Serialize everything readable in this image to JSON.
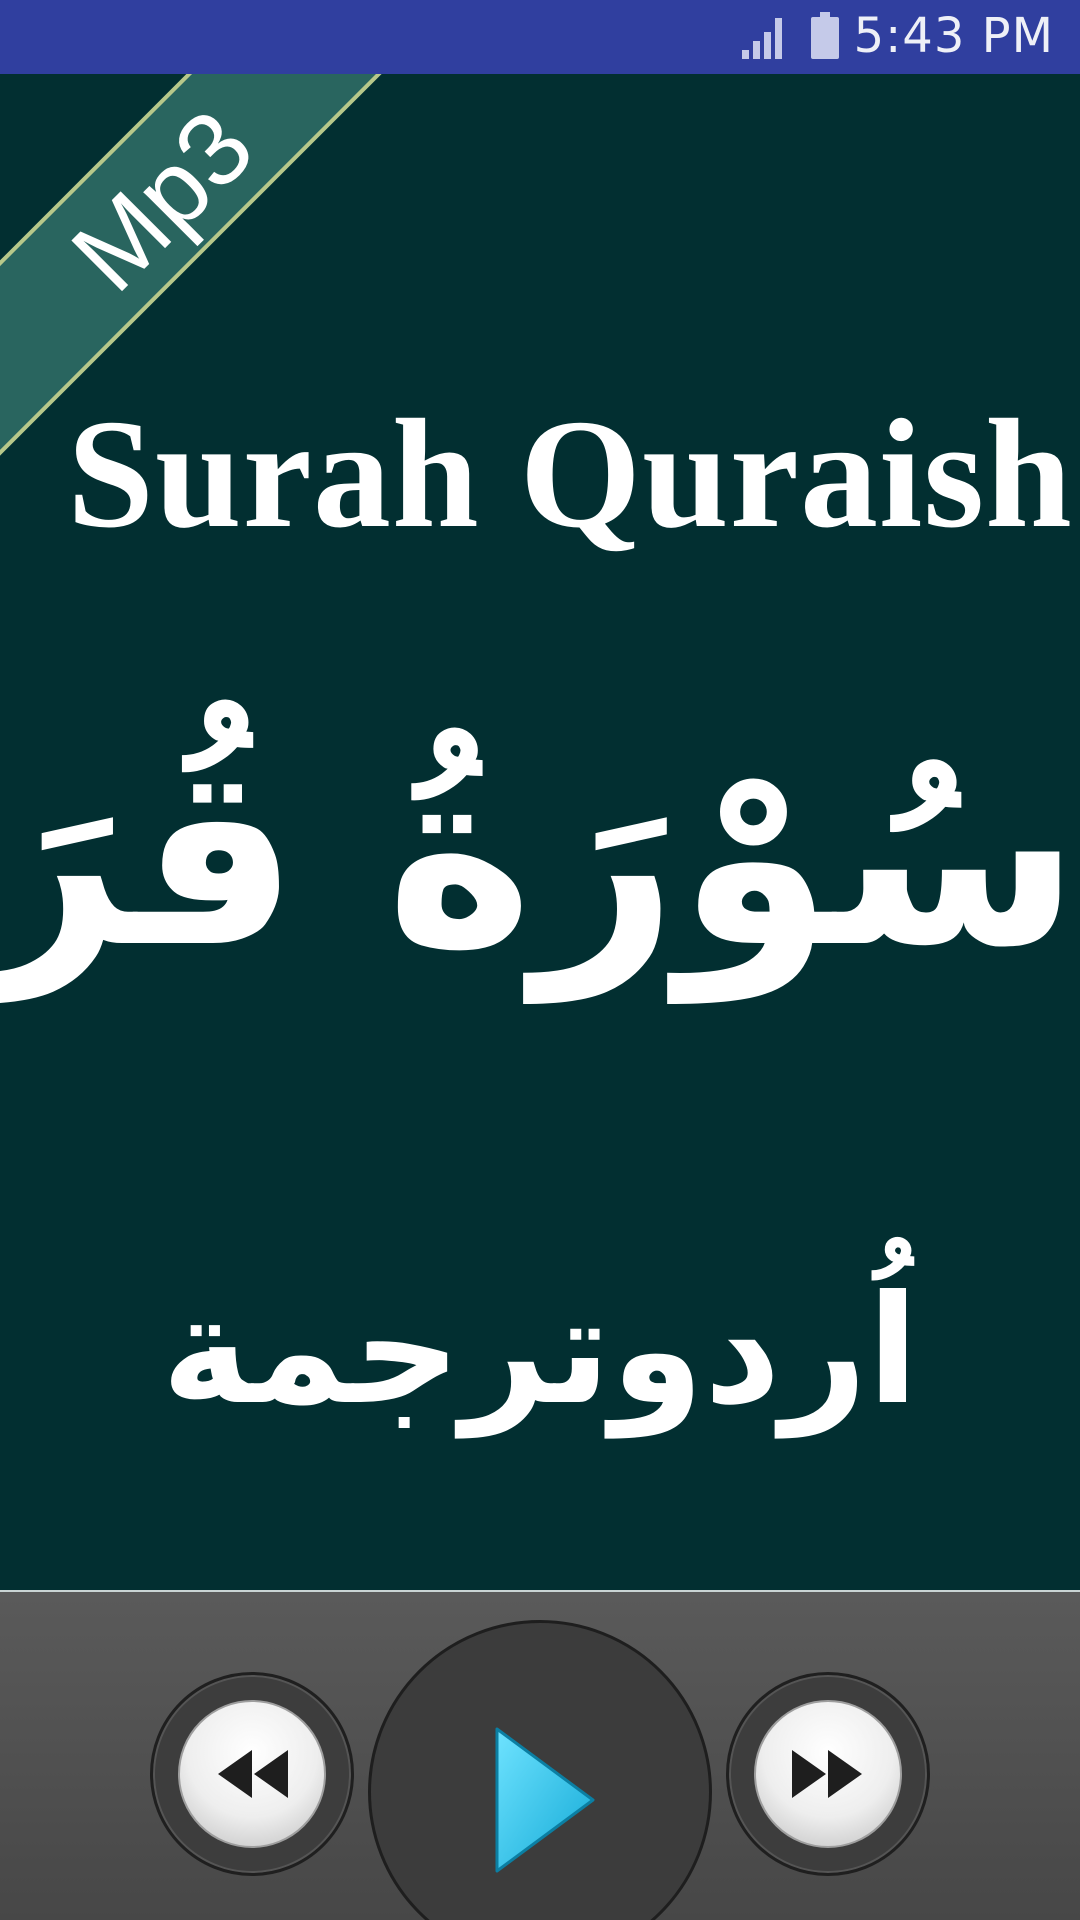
{
  "status_bar": {
    "time": "5:43 PM",
    "icons": [
      "signal-icon",
      "battery-icon"
    ]
  },
  "cover": {
    "ribbon_label": "Mp3",
    "english_title": "Surah Quraish",
    "arabic_title": "سُوْرَةُ قُرَيش",
    "urdu_subtitle": "اُردوترجمة"
  },
  "player": {
    "controls": [
      "rewind-icon",
      "play-icon",
      "fast-forward-icon"
    ]
  },
  "colors": {
    "status_bar": "#303f9f",
    "background": "#022f31",
    "ribbon": "#29655f",
    "ribbon_border": "#b7c88a",
    "player_bar": "#4f4f4f",
    "play_accent": "#29c4e8"
  }
}
